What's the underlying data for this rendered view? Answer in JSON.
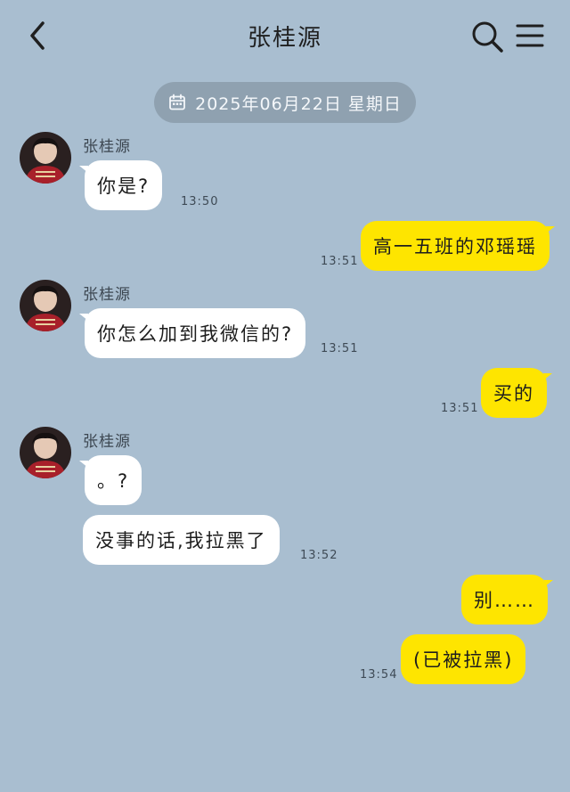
{
  "header": {
    "title": "张桂源",
    "back_icon": "chevron-left-icon",
    "search_icon": "search-icon",
    "menu_icon": "menu-icon"
  },
  "date_divider": {
    "text": "2025年06月22日 星期日",
    "icon": "calendar-icon"
  },
  "messages": [
    {
      "sender": "张桂源",
      "text": "你是?",
      "time": "13:50"
    },
    {
      "sender": "me",
      "text": "高一五班的邓瑶瑶",
      "time": "13:51"
    },
    {
      "sender": "张桂源",
      "text": "你怎么加到我微信的?",
      "time": "13:51"
    },
    {
      "sender": "me",
      "text": "买的",
      "time": "13:51"
    },
    {
      "sender": "张桂源",
      "text": "。?",
      "time": ""
    },
    {
      "sender": "张桂源",
      "text": "没事的话,我拉黑了",
      "time": "13:52"
    },
    {
      "sender": "me",
      "text": "别……",
      "time": ""
    },
    {
      "sender": "me",
      "text": "(已被拉黑)",
      "time": "13:54"
    }
  ],
  "colors": {
    "background": "#a9bed0",
    "incoming_bubble": "#ffffff",
    "outgoing_bubble": "#fee500",
    "date_pill": "#8fa1b0"
  }
}
